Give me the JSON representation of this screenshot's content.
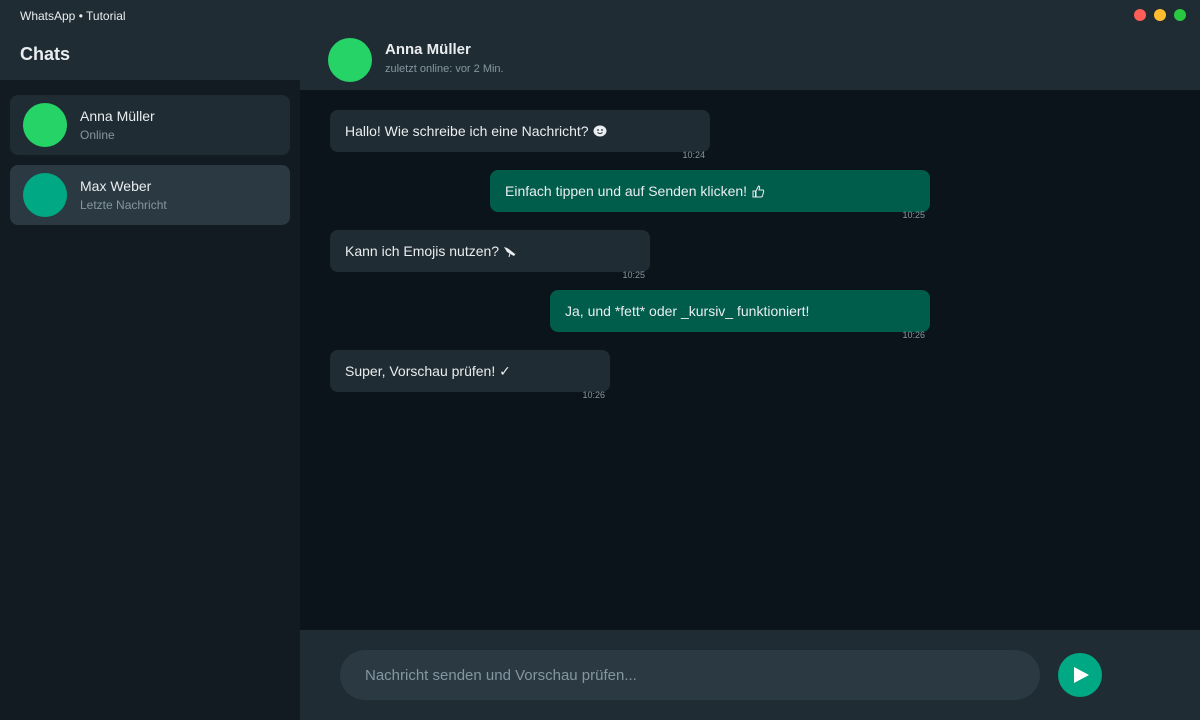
{
  "window": {
    "title": "WhatsApp • Tutorial",
    "controls": [
      "close",
      "minimize",
      "maximize"
    ]
  },
  "sidebar": {
    "title": "Chats",
    "chats": [
      {
        "name": "Anna Müller",
        "subtitle": "Online",
        "avatar_color": "#25d366",
        "active": false
      },
      {
        "name": "Max Weber",
        "subtitle": "Letzte Nachricht",
        "avatar_color": "#00a884",
        "active": true
      }
    ]
  },
  "conversation": {
    "contact_name": "Anna Müller",
    "status": "zuletzt online: vor 2 Min.",
    "messages": [
      {
        "direction": "incoming",
        "text": "Hallo! Wie schreibe ich eine Nachricht?",
        "icon": "smiley-emoji",
        "time": "10:24"
      },
      {
        "direction": "outgoing",
        "text": "Einfach tippen und auf Senden klicken!",
        "icon": "thumbs-up-emoji",
        "time": "10:25"
      },
      {
        "direction": "incoming",
        "text": "Kann ich Emojis nutzen?",
        "icon": "bird-emoji",
        "time": "10:25"
      },
      {
        "direction": "outgoing",
        "text": "Ja, und *fett* oder _kursiv_ funktioniert!",
        "icon": "",
        "time": "10:26"
      },
      {
        "direction": "incoming",
        "text": "Super, Vorschau prüfen! ✓",
        "icon": "",
        "time": "10:26"
      }
    ]
  },
  "composer": {
    "placeholder": "Nachricht senden und Vorschau prüfen...",
    "value": "",
    "send_icon": "send-arrow-icon"
  },
  "colors": {
    "accent": "#00a884",
    "online_green": "#25d366",
    "incoming_bubble": "#202c33",
    "outgoing_bubble": "#005c4b",
    "panel": "#1f2c33",
    "background": "#0b141a"
  }
}
